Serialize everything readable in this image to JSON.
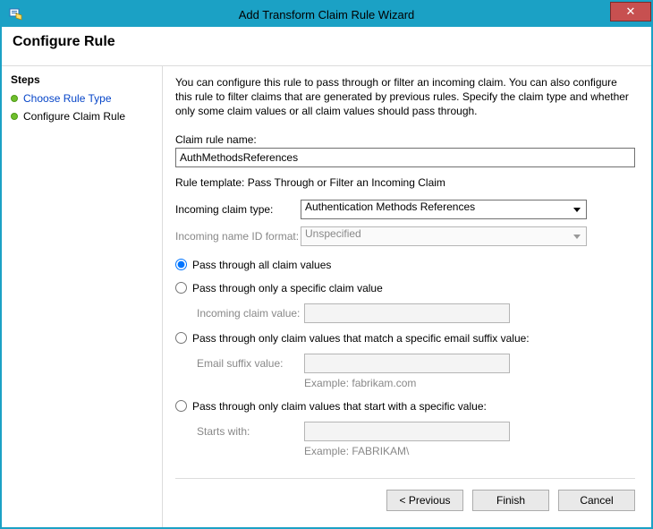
{
  "window": {
    "title": "Add Transform Claim Rule Wizard",
    "close_glyph": "✕"
  },
  "header": {
    "title": "Configure Rule"
  },
  "sidebar": {
    "heading": "Steps",
    "items": [
      {
        "label": "Choose Rule Type"
      },
      {
        "label": "Configure Claim Rule"
      }
    ]
  },
  "main": {
    "intro": "You can configure this rule to pass through or filter an incoming claim. You can also configure this rule to filter claims that are generated by previous rules. Specify the claim type and whether only some claim values or all claim values should pass through.",
    "claim_rule_name_label": "Claim rule name:",
    "claim_rule_name_value": "AuthMethodsReferences",
    "template_line": "Rule template: Pass Through or Filter an Incoming Claim",
    "incoming_claim_type_label": "Incoming claim type:",
    "incoming_claim_type_value": "Authentication Methods References",
    "incoming_name_id_format_label": "Incoming name ID format:",
    "incoming_name_id_format_value": "Unspecified",
    "radios": {
      "all": "Pass through all claim values",
      "specific": "Pass through only a specific claim value",
      "email_suffix": "Pass through only claim values that match a specific email suffix value:",
      "starts_with": "Pass through only claim values that start with a specific value:"
    },
    "sublabels": {
      "incoming_claim_value": "Incoming claim value:",
      "email_suffix_value": "Email suffix value:",
      "starts_with": "Starts with:"
    },
    "examples": {
      "email_suffix": "Example: fabrikam.com",
      "starts_with": "Example: FABRIKAM\\"
    }
  },
  "footer": {
    "previous": "< Previous",
    "finish": "Finish",
    "cancel": "Cancel"
  }
}
